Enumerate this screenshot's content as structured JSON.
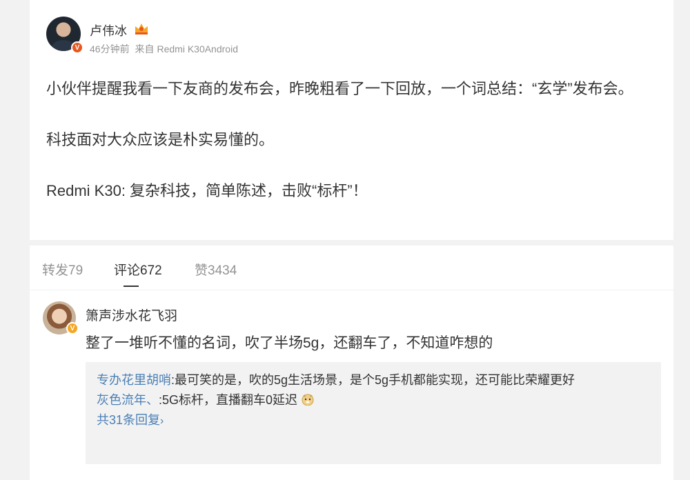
{
  "post": {
    "author": "卢伟冰",
    "time": "46分钟前",
    "source_prefix": "来自",
    "source": "Redmi K30Android",
    "paragraphs": [
      "小伙伴提醒我看一下友商的发布会，昨晚粗看了一下回放，一个词总结：“玄学”发布会。",
      "科技面对大众应该是朴实易懂的。",
      "Redmi K30: 复杂科技，简单陈述，击败“标杆”！"
    ]
  },
  "tabs": {
    "repost": "转发79",
    "comment": "评论672",
    "like": "赞3434"
  },
  "comment": {
    "user": "箫声涉水花飞羽",
    "text": "整了一堆听不懂的名词，吹了半场5g，还翻车了，不知道咋想的",
    "replies": [
      {
        "user": "专办花里胡哨",
        "text": ":最可笑的是，吹的5g生活场景，是个5g手机都能实现，还可能比荣耀更好"
      },
      {
        "user": "灰色流年、",
        "text": ":5G标杆，直播翻车0延迟"
      }
    ],
    "more": "共31条回复"
  },
  "colors": {
    "link": "#4a7fb5",
    "muted": "#939393",
    "badge_orange": "#f5a623"
  },
  "icons": {
    "verified": "verified-badge-icon",
    "crown": "crown-icon",
    "emoji": "doge-emoji-icon",
    "chevron": "chevron-right-icon"
  }
}
